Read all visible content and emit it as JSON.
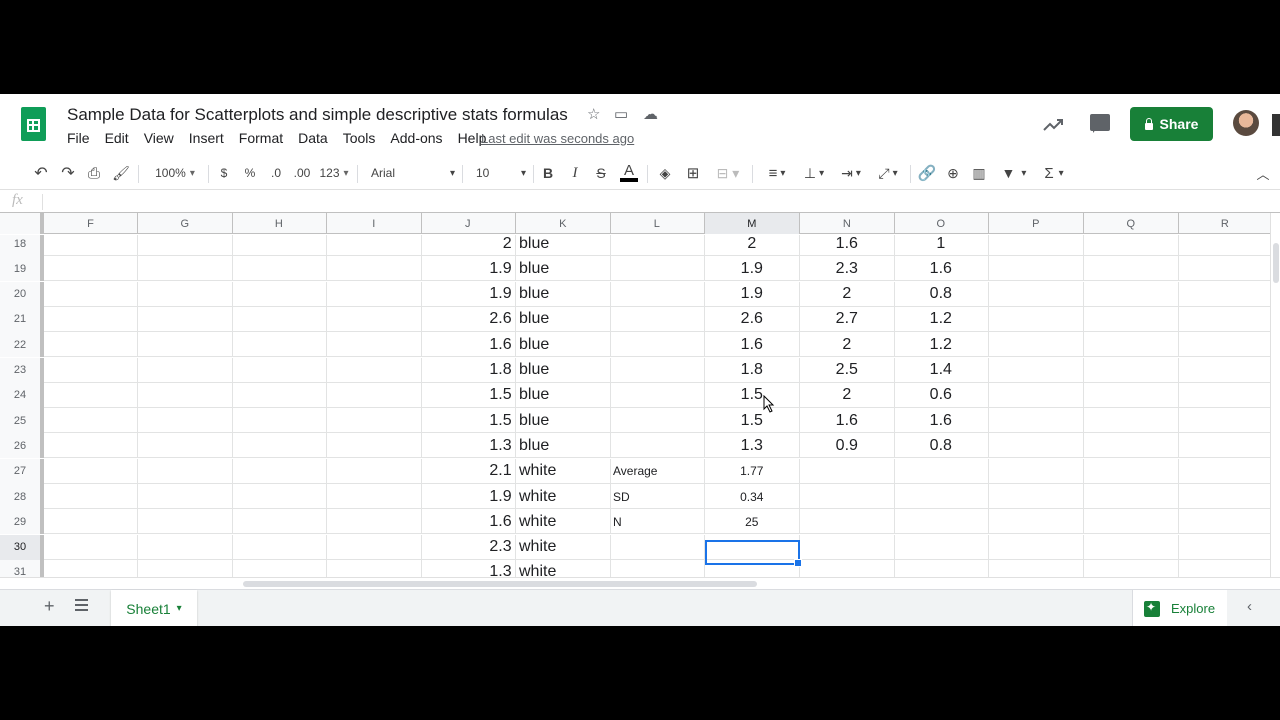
{
  "doc": {
    "title": "Sample Data for Scatterplots and simple descriptive stats formulas",
    "menus": [
      "File",
      "Edit",
      "View",
      "Insert",
      "Format",
      "Data",
      "Tools",
      "Add-ons",
      "Help"
    ],
    "last_edit": "Last edit was seconds ago",
    "share_label": "Share"
  },
  "toolbar": {
    "zoom": "100%",
    "currency": "$",
    "percent": "%",
    "dec_less": ".0",
    "dec_more": ".00",
    "more_formats": "123",
    "font": "Arial",
    "size": "10",
    "bold": "B",
    "italic": "I",
    "strike": "S",
    "text_color": "A"
  },
  "formula_bar": {
    "label": "fx",
    "value": ""
  },
  "columns": [
    "F",
    "G",
    "H",
    "I",
    "J",
    "K",
    "L",
    "M",
    "N",
    "O",
    "P",
    "Q",
    "R"
  ],
  "selected_column": "M",
  "rows": [
    {
      "n": "18",
      "J": "2",
      "K": "blue",
      "L": "",
      "M": "2",
      "N": "1.6",
      "O": "1"
    },
    {
      "n": "19",
      "J": "1.9",
      "K": "blue",
      "L": "",
      "M": "1.9",
      "N": "2.3",
      "O": "1.6"
    },
    {
      "n": "20",
      "J": "1.9",
      "K": "blue",
      "L": "",
      "M": "1.9",
      "N": "2",
      "O": "0.8"
    },
    {
      "n": "21",
      "J": "2.6",
      "K": "blue",
      "L": "",
      "M": "2.6",
      "N": "2.7",
      "O": "1.2"
    },
    {
      "n": "22",
      "J": "1.6",
      "K": "blue",
      "L": "",
      "M": "1.6",
      "N": "2",
      "O": "1.2"
    },
    {
      "n": "23",
      "J": "1.8",
      "K": "blue",
      "L": "",
      "M": "1.8",
      "N": "2.5",
      "O": "1.4"
    },
    {
      "n": "24",
      "J": "1.5",
      "K": "blue",
      "L": "",
      "M": "1.5",
      "N": "2",
      "O": "0.6"
    },
    {
      "n": "25",
      "J": "1.5",
      "K": "blue",
      "L": "",
      "M": "1.5",
      "N": "1.6",
      "O": "1.6"
    },
    {
      "n": "26",
      "J": "1.3",
      "K": "blue",
      "L": "",
      "M": "1.3",
      "N": "0.9",
      "O": "0.8"
    },
    {
      "n": "27",
      "J": "2.1",
      "K": "white",
      "L": "Average",
      "M": "1.77",
      "N": "",
      "O": ""
    },
    {
      "n": "28",
      "J": "1.9",
      "K": "white",
      "L": "SD",
      "M": "0.34",
      "N": "",
      "O": ""
    },
    {
      "n": "29",
      "J": "1.6",
      "K": "white",
      "L": "N",
      "M": "25",
      "N": "",
      "O": ""
    },
    {
      "n": "30",
      "J": "2.3",
      "K": "white",
      "L": "",
      "M": "",
      "N": "",
      "O": ""
    },
    {
      "n": "31",
      "J": "1.3",
      "K": "white",
      "L": "",
      "M": "",
      "N": "",
      "O": ""
    }
  ],
  "selected_row": "30",
  "sheet_tab": "Sheet1",
  "explore_label": "Explore",
  "colors": {
    "brand_green": "#188038",
    "selection_blue": "#1a73e8"
  }
}
